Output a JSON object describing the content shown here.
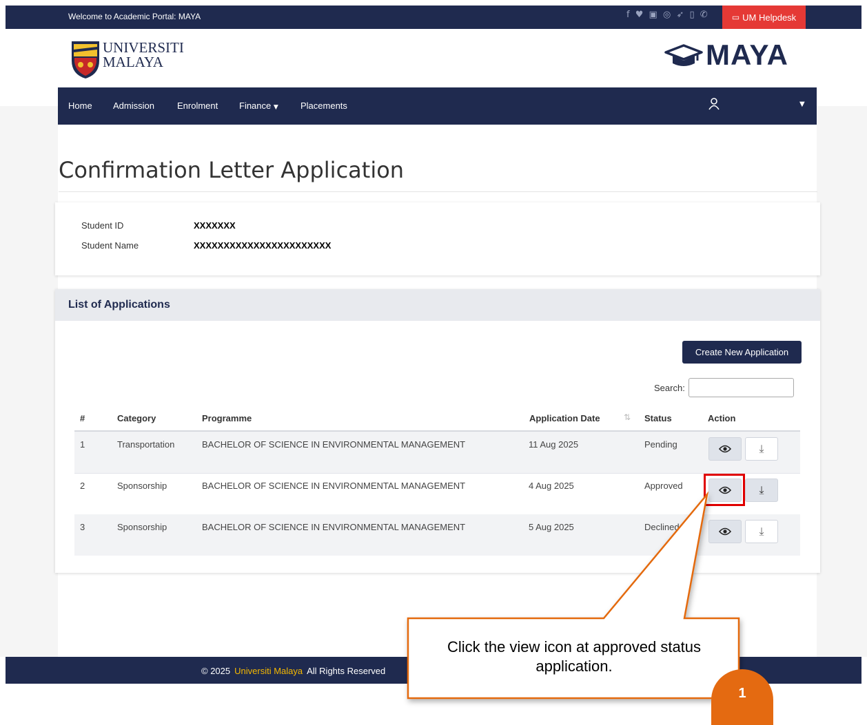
{
  "topbar": {
    "welcome": "Welcome to Academic Portal: MAYA",
    "social_icons": [
      "facebook-icon",
      "twitter-icon",
      "youtube-icon",
      "instagram-icon",
      "telegram-icon",
      "tablet-icon",
      "phone-icon"
    ],
    "helpdesk_label": "UM Helpdesk"
  },
  "header": {
    "univ_line1": "UNIVERSITI",
    "univ_line2": "MALAYA",
    "brand": "MAYA"
  },
  "nav": {
    "home": "Home",
    "admission": "Admission",
    "enrolment": "Enrolment",
    "finance": "Finance",
    "placements": "Placements"
  },
  "page": {
    "title": "Confirmation Letter Application"
  },
  "student": {
    "id_label": "Student ID",
    "id_value": "XXXXXXX",
    "name_label": "Student Name",
    "name_value": "XXXXXXXXXXXXXXXXXXXXXXX"
  },
  "list": {
    "title": "List of Applications",
    "create_label": "Create New Application",
    "search_label": "Search:",
    "search_value": "",
    "headers": {
      "num": "#",
      "category": "Category",
      "programme": "Programme",
      "date": "Application Date",
      "status": "Status",
      "action": "Action"
    },
    "rows": [
      {
        "num": "1",
        "category": "Transportation",
        "programme": "BACHELOR OF SCIENCE IN ENVIRONMENTAL MANAGEMENT",
        "date": "11 Aug 2025",
        "status": "Pending"
      },
      {
        "num": "2",
        "category": "Sponsorship",
        "programme": "BACHELOR OF SCIENCE IN ENVIRONMENTAL MANAGEMENT",
        "date": "4 Aug 2025",
        "status": "Approved"
      },
      {
        "num": "3",
        "category": "Sponsorship",
        "programme": "BACHELOR OF SCIENCE IN ENVIRONMENTAL MANAGEMENT",
        "date": "5 Aug 2025",
        "status": "Declined"
      }
    ]
  },
  "footer": {
    "copyright": "© 2025",
    "org": "Universiti Malaya",
    "rights": "All Rights Reserved"
  },
  "annotation": {
    "callout_text": "Click the view icon at approved status application.",
    "step": "1"
  },
  "colors": {
    "navy": "#1f2a4f",
    "helpdesk_red": "#e53935",
    "footer_link": "#f5b800",
    "callout_orange": "#e46a11",
    "highlight_red": "#e00000"
  }
}
